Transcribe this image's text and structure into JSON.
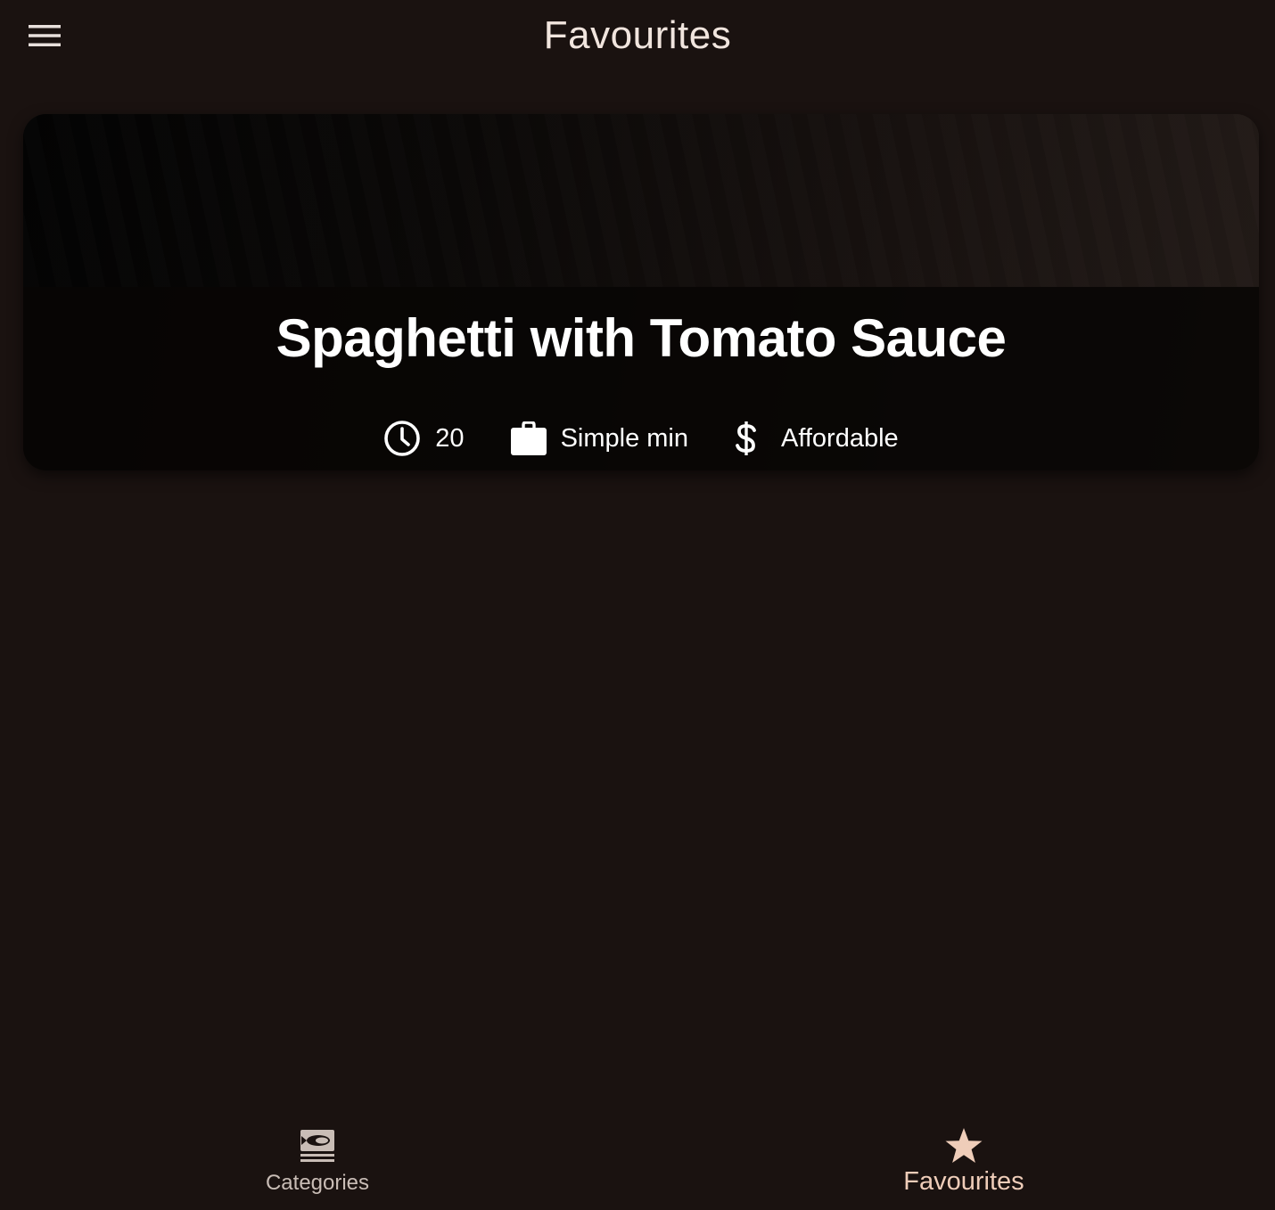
{
  "app_bar": {
    "title": "Favourites",
    "menu_icon": "hamburger-menu-icon"
  },
  "meal": {
    "title": "Spaghetti with Tomato Sauce",
    "duration": "20",
    "complexity": "Simple min",
    "affordability": "Affordable",
    "icons": {
      "duration": "clock-icon",
      "complexity": "briefcase-icon",
      "affordability": "dollar-icon"
    }
  },
  "bottom_nav": {
    "items": [
      {
        "label": "Categories",
        "icon": "set-meal-icon",
        "selected": false
      },
      {
        "label": "Favourites",
        "icon": "star-icon",
        "selected": true
      }
    ]
  },
  "colors": {
    "background": "#1a1210",
    "title_text": "#f1e5de",
    "accent_selected": "#efcdb9",
    "nav_unselected": "#c9bdb6"
  }
}
